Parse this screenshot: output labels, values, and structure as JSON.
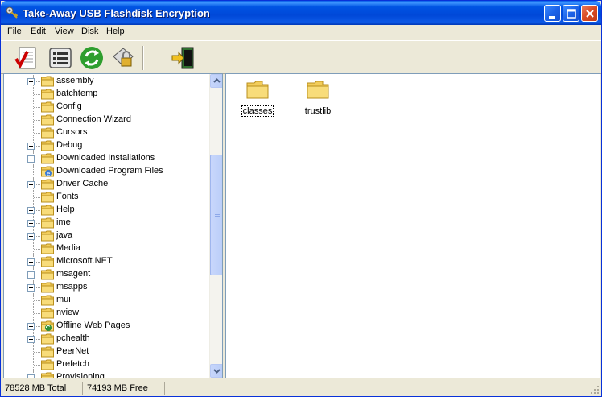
{
  "window": {
    "title": "Take-Away USB Flashdisk Encryption",
    "title_icon": "app-key-icon",
    "controls": [
      "minimize-icon",
      "maximize-icon",
      "close-icon"
    ]
  },
  "menu": {
    "items": [
      "File",
      "Edit",
      "View",
      "Disk",
      "Help"
    ]
  },
  "toolbar": {
    "buttons": [
      {
        "icon": "checklist-icon"
      },
      {
        "icon": "details-list-icon"
      },
      {
        "icon": "refresh-icon"
      },
      {
        "icon": "lock-folder-icon"
      },
      {
        "icon": "exit-door-icon"
      }
    ]
  },
  "tree": {
    "items": [
      {
        "label": "assembly",
        "expandable": true,
        "icon": "folder-icon"
      },
      {
        "label": "batchtemp",
        "expandable": false,
        "icon": "folder-icon"
      },
      {
        "label": "Config",
        "expandable": false,
        "icon": "folder-icon"
      },
      {
        "label": "Connection Wizard",
        "expandable": false,
        "icon": "folder-icon"
      },
      {
        "label": "Cursors",
        "expandable": false,
        "icon": "folder-icon"
      },
      {
        "label": "Debug",
        "expandable": true,
        "icon": "folder-icon"
      },
      {
        "label": "Downloaded Installations",
        "expandable": true,
        "icon": "folder-icon"
      },
      {
        "label": "Downloaded Program Files",
        "expandable": false,
        "icon": "ie-folder-icon"
      },
      {
        "label": "Driver Cache",
        "expandable": true,
        "icon": "folder-icon"
      },
      {
        "label": "Fonts",
        "expandable": false,
        "icon": "folder-icon"
      },
      {
        "label": "Help",
        "expandable": true,
        "icon": "folder-icon"
      },
      {
        "label": "ime",
        "expandable": true,
        "icon": "folder-icon"
      },
      {
        "label": "java",
        "expandable": true,
        "icon": "folder-icon"
      },
      {
        "label": "Media",
        "expandable": false,
        "icon": "folder-icon"
      },
      {
        "label": "Microsoft.NET",
        "expandable": true,
        "icon": "folder-icon"
      },
      {
        "label": "msagent",
        "expandable": true,
        "icon": "folder-icon"
      },
      {
        "label": "msapps",
        "expandable": true,
        "icon": "folder-icon"
      },
      {
        "label": "mui",
        "expandable": false,
        "icon": "folder-icon"
      },
      {
        "label": "nview",
        "expandable": false,
        "icon": "folder-icon"
      },
      {
        "label": "Offline Web Pages",
        "expandable": true,
        "icon": "offline-folder-icon"
      },
      {
        "label": "pchealth",
        "expandable": true,
        "icon": "folder-icon"
      },
      {
        "label": "PeerNet",
        "expandable": false,
        "icon": "folder-icon"
      },
      {
        "label": "Prefetch",
        "expandable": false,
        "icon": "folder-icon"
      },
      {
        "label": "Provisioning",
        "expandable": true,
        "icon": "folder-icon"
      }
    ]
  },
  "files": {
    "items": [
      {
        "label": "classes",
        "icon": "folder-icon",
        "focused": true
      },
      {
        "label": "trustlib",
        "icon": "folder-icon",
        "focused": false
      }
    ]
  },
  "status": {
    "total": "78528 MB Total",
    "free": "74193 MB Free"
  },
  "colors": {
    "titlebar": "#0054e3",
    "face": "#ece9d8",
    "border": "#7f9db9",
    "folder": "#f5d76e"
  }
}
